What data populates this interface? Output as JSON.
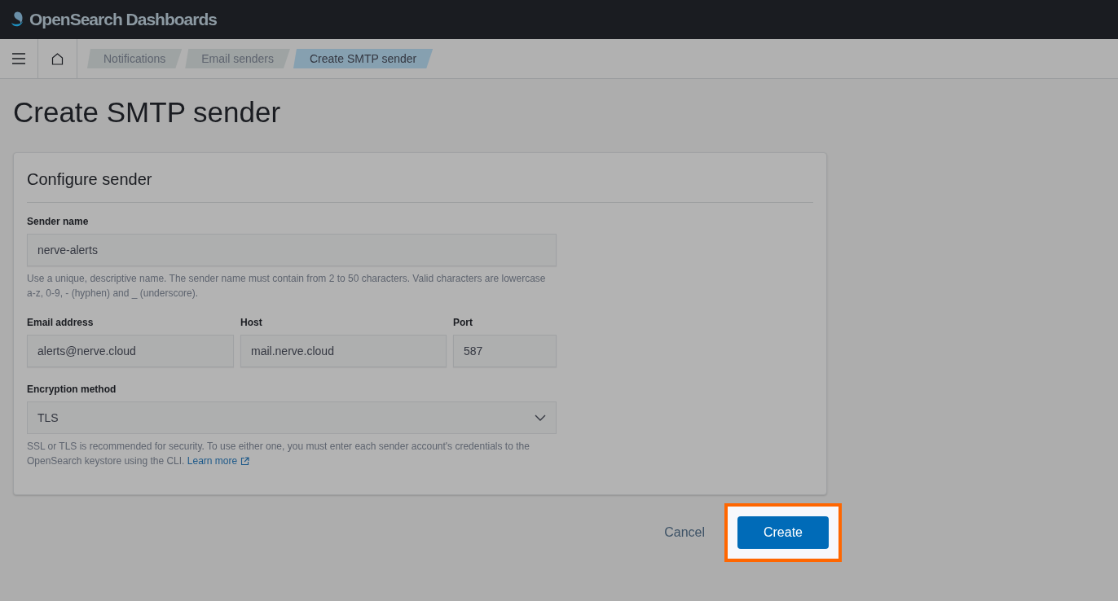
{
  "header": {
    "logo_text": "OpenSearch Dashboards"
  },
  "breadcrumbs": [
    {
      "label": "Notifications",
      "selected": false
    },
    {
      "label": "Email senders",
      "selected": false
    },
    {
      "label": "Create SMTP sender",
      "selected": true
    }
  ],
  "page_title": "Create SMTP sender",
  "panel": {
    "title": "Configure sender",
    "sender_name": {
      "label": "Sender name",
      "value": "nerve-alerts",
      "help": "Use a unique, descriptive name. The sender name must contain from 2 to 50 characters. Valid characters are lowercase a-z, 0-9, - (hyphen) and _ (underscore)."
    },
    "row_fields": [
      {
        "label": "Email address",
        "value": "alerts@nerve.cloud"
      },
      {
        "label": "Host",
        "value": "mail.nerve.cloud"
      },
      {
        "label": "Port",
        "value": "587"
      }
    ],
    "encryption": {
      "label": "Encryption method",
      "value": "TLS",
      "help": "SSL or TLS is recommended for security. To use either one, you must enter each sender account's credentials to the OpenSearch keystore using the CLI.",
      "link": "Learn more"
    }
  },
  "actions": {
    "cancel": "Cancel",
    "create": "Create",
    "create_highlighted": true
  }
}
